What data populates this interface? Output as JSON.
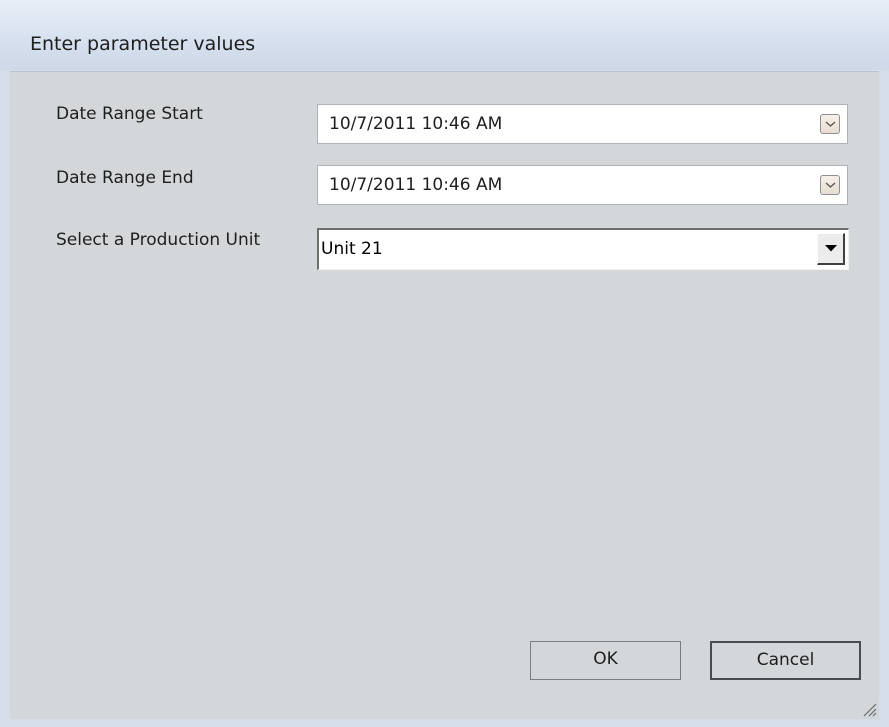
{
  "dialog": {
    "title": "Enter parameter values"
  },
  "fields": {
    "date_start": {
      "label": "Date Range Start",
      "value": "10/7/2011 10:46 AM"
    },
    "date_end": {
      "label": "Date Range End",
      "value": "10/7/2011 10:46 AM"
    },
    "production_unit": {
      "label": "Select a Production Unit",
      "value": "Unit 21"
    }
  },
  "buttons": {
    "ok_label": "OK",
    "cancel_label": "Cancel"
  },
  "icons": {
    "date_dropdown": "chevron-down-icon",
    "combo_dropdown": "triangle-down-icon",
    "resize": "resize-grip-icon"
  }
}
